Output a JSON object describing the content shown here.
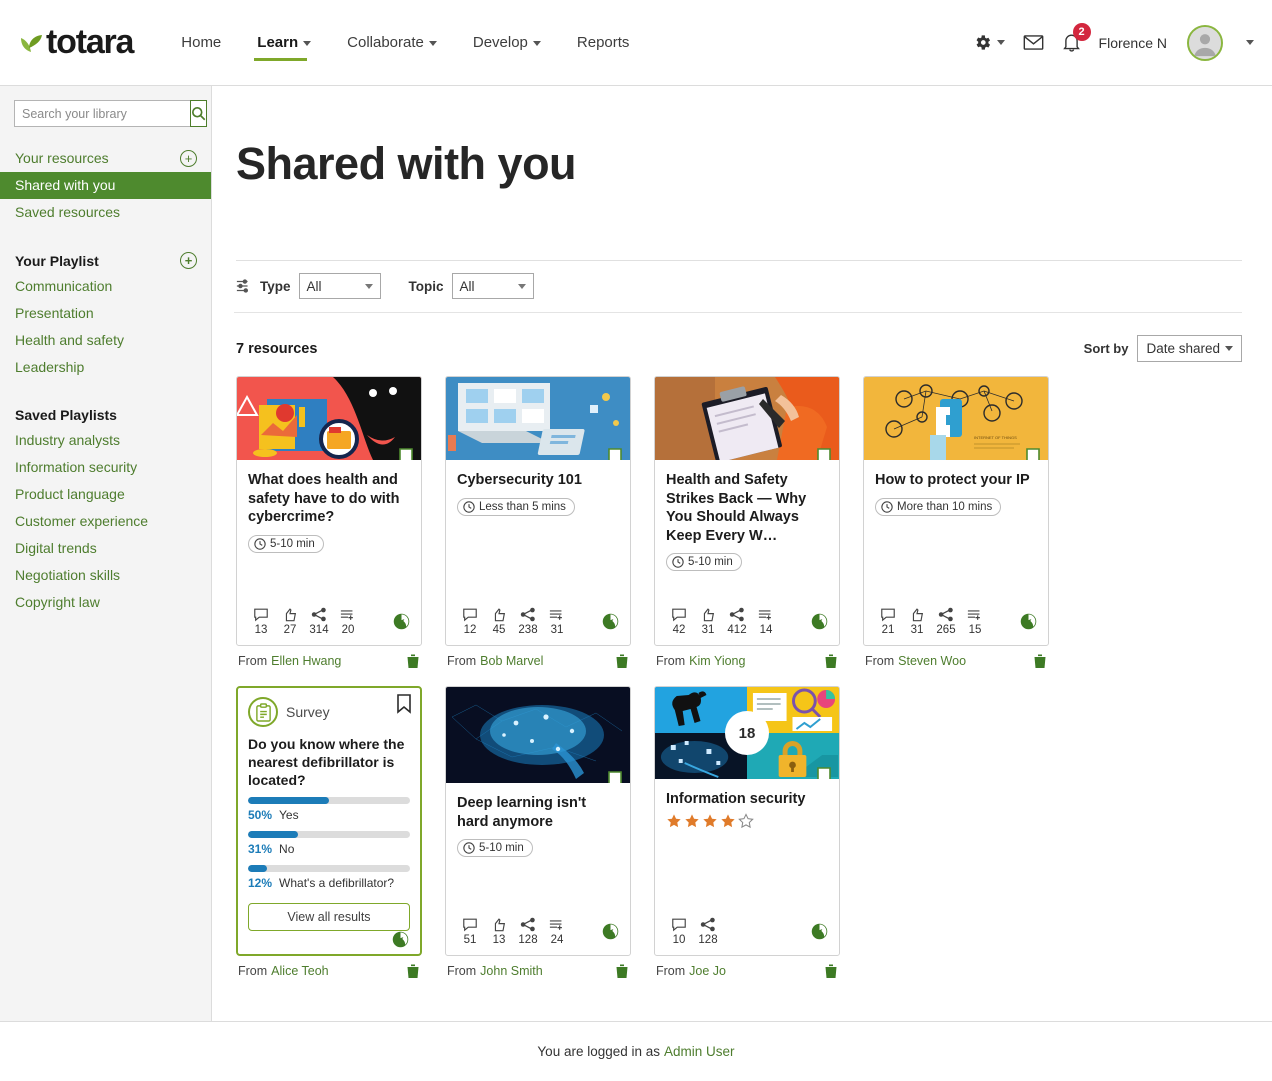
{
  "header": {
    "brand": "totara",
    "nav": [
      {
        "label": "Home",
        "has_caret": false,
        "active": false
      },
      {
        "label": "Learn",
        "has_caret": true,
        "active": true
      },
      {
        "label": "Collaborate",
        "has_caret": true,
        "active": false
      },
      {
        "label": "Develop",
        "has_caret": true,
        "active": false
      },
      {
        "label": "Reports",
        "has_caret": false,
        "active": false
      }
    ],
    "gear_icon": "gear-icon",
    "messages_icon": "envelope-icon",
    "notifications_icon": "bell-icon",
    "notification_count": "2",
    "username": "Florence N",
    "accent_green": "#7fa82a",
    "badge_red": "#d3273e"
  },
  "sidebar": {
    "search_placeholder": "Search your library",
    "search_value": "",
    "links": [
      {
        "label": "Your resources",
        "add": true,
        "active": false
      },
      {
        "label": "Shared with you",
        "add": false,
        "active": true
      },
      {
        "label": "Saved resources",
        "add": false,
        "active": false
      }
    ],
    "playlist_heading": "Your Playlist",
    "playlist_items": [
      {
        "label": "Communication"
      },
      {
        "label": "Presentation"
      },
      {
        "label": "Health and safety"
      },
      {
        "label": "Leadership"
      }
    ],
    "saved_heading": "Saved Playlists",
    "saved_items": [
      {
        "label": "Industry analysts"
      },
      {
        "label": "Information security"
      },
      {
        "label": "Product language"
      },
      {
        "label": "Customer experience"
      },
      {
        "label": "Digital trends"
      },
      {
        "label": "Negotiation skills"
      },
      {
        "label": "Copyright law"
      }
    ],
    "active_bg": "#4e8a2e",
    "link_color": "#4e7d2e"
  },
  "main": {
    "page_title": "Shared with you",
    "filters": {
      "type_label": "Type",
      "type_value": "All",
      "topic_label": "Topic",
      "topic_value": "All"
    },
    "results_count": "7 resources",
    "sort_label": "Sort by",
    "sort_value": "Date shared"
  },
  "cards": [
    {
      "kind": "resource",
      "title": "What does health and safety have to do with cybercrime?",
      "duration": "5-10 min",
      "stats": {
        "comments": "13",
        "likes": "27",
        "shares": "314",
        "playlists": "20"
      },
      "from_label": "From",
      "from_name": "Ellen Hwang",
      "image": "cybercrime-illustration"
    },
    {
      "kind": "resource",
      "title": "Cybersecurity 101",
      "duration": "Less than 5 mins",
      "stats": {
        "comments": "12",
        "likes": "45",
        "shares": "238",
        "playlists": "31"
      },
      "from_label": "From",
      "from_name": "Bob Marvel",
      "image": "isometric-computer-illustration"
    },
    {
      "kind": "resource",
      "title": "Health and Safety Strikes Back — Why You Should Always Keep Every W…",
      "duration": "5-10 min",
      "stats": {
        "comments": "42",
        "likes": "31",
        "shares": "412",
        "playlists": "14"
      },
      "from_label": "From",
      "from_name": "Kim Yiong",
      "image": "clipboard-photo"
    },
    {
      "kind": "resource",
      "title": "How to protect your IP",
      "duration": "More than 10 mins",
      "stats": {
        "comments": "21",
        "likes": "31",
        "shares": "265",
        "playlists": "15"
      },
      "from_label": "From",
      "from_name": "Steven Woo",
      "image": "iot-illustration"
    },
    {
      "kind": "survey",
      "survey_type": "Survey",
      "question": "Do you know where the nearest defibrillator is located?",
      "options": [
        {
          "pct": "50%",
          "label": "Yes",
          "value": 50
        },
        {
          "pct": "31%",
          "label": "No",
          "value": 31
        },
        {
          "pct": "12%",
          "label": "What's a defibrillator?",
          "value": 12
        }
      ],
      "view_results_label": "View all results",
      "from_label": "From",
      "from_name": "Alice Teoh",
      "bar_color": "#1c7cb8",
      "border_color": "#7fa82a"
    },
    {
      "kind": "resource",
      "title": "Deep learning isn't hard anymore",
      "duration": "5-10 min",
      "stats": {
        "comments": "51",
        "likes": "13",
        "shares": "128",
        "playlists": "24"
      },
      "from_label": "From",
      "from_name": "John Smith",
      "image": "brain-network-photo"
    },
    {
      "kind": "playlist",
      "title": "Information security",
      "item_count": "18",
      "rating": 4,
      "rating_max": 5,
      "stats": {
        "comments": "10",
        "shares": "128"
      },
      "from_label": "From",
      "from_name": "Joe Jo",
      "image": "infosec-tile-grid"
    }
  ],
  "footer": {
    "text": "You are logged in as",
    "user_link": "Admin User"
  }
}
